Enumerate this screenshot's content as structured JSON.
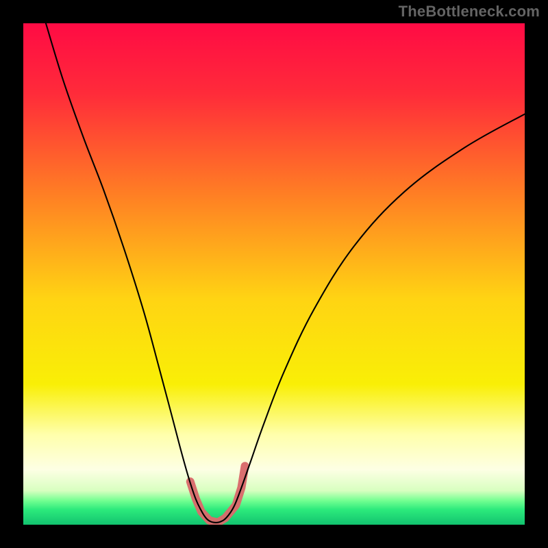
{
  "watermark": "TheBottleneck.com",
  "chart_data": {
    "type": "line",
    "title": "",
    "xlabel": "",
    "ylabel": "",
    "xlim": [
      0,
      100
    ],
    "ylim": [
      0,
      100
    ],
    "gradient_stops": [
      {
        "pct": 0,
        "color": "#ff0b44"
      },
      {
        "pct": 14,
        "color": "#ff2b3a"
      },
      {
        "pct": 34,
        "color": "#ff7e24"
      },
      {
        "pct": 55,
        "color": "#ffd413"
      },
      {
        "pct": 72,
        "color": "#f9ef06"
      },
      {
        "pct": 82,
        "color": "#ffffab"
      },
      {
        "pct": 89,
        "color": "#fdffe4"
      },
      {
        "pct": 93.2,
        "color": "#d8ffc0"
      },
      {
        "pct": 95.2,
        "color": "#73ff91"
      },
      {
        "pct": 97,
        "color": "#2cea7c"
      },
      {
        "pct": 100,
        "color": "#12c36f"
      }
    ],
    "series": [
      {
        "name": "bottleneck-curve",
        "stroke": "#000000",
        "width": 2.1,
        "x": [
          4.5,
          8,
          12,
          16,
          20,
          24,
          27,
          29.5,
          31.5,
          33,
          34.4,
          35.5,
          36.3,
          37,
          38,
          39.2,
          40.5,
          42,
          43.5,
          45.3,
          48,
          52,
          58,
          66,
          76,
          88,
          100
        ],
        "y": [
          100,
          88.5,
          77.2,
          66.8,
          55.3,
          42.6,
          31.6,
          22.2,
          14.6,
          9.3,
          5.1,
          2.8,
          1.5,
          0.82,
          0.45,
          0.55,
          1.4,
          3.6,
          7.4,
          12.5,
          20.2,
          30.5,
          43,
          55.6,
          66.4,
          75.2,
          81.9
        ]
      },
      {
        "name": "highlight-dots",
        "stroke": "#d96a6b",
        "width": 12,
        "linecap": "round",
        "x": [
          33.3,
          34.4,
          35.5,
          37.1,
          38.8,
          40.3,
          42.4,
          43.5,
          43.8,
          44.2
        ],
        "y": [
          8.6,
          5.2,
          2.6,
          0.85,
          0.45,
          1.35,
          3.9,
          7.4,
          9.2,
          11.7
        ]
      }
    ]
  }
}
